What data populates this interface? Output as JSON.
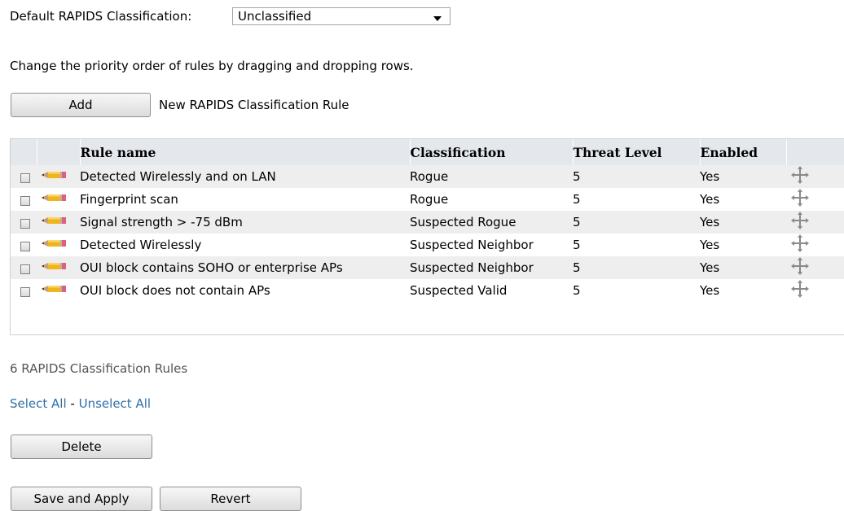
{
  "default_classification": {
    "label": "Default RAPIDS Classification:",
    "value": "Unclassified"
  },
  "instruction": "Change the priority order of rules by dragging and dropping rows.",
  "add": {
    "button_label": "Add",
    "description": "New RAPIDS Classification Rule"
  },
  "table": {
    "headers": [
      "Rule name",
      "Classification",
      "Threat Level",
      "Enabled"
    ],
    "rows": [
      {
        "name": "Detected Wirelessly and on LAN",
        "classification": "Rogue",
        "threat": "5",
        "enabled": "Yes"
      },
      {
        "name": "Fingerprint scan",
        "classification": "Rogue",
        "threat": "5",
        "enabled": "Yes"
      },
      {
        "name": "Signal strength > -75 dBm",
        "classification": "Suspected Rogue",
        "threat": "5",
        "enabled": "Yes"
      },
      {
        "name": "Detected Wirelessly",
        "classification": "Suspected Neighbor",
        "threat": "5",
        "enabled": "Yes"
      },
      {
        "name": "OUI block contains SOHO or enterprise APs",
        "classification": "Suspected Neighbor",
        "threat": "5",
        "enabled": "Yes"
      },
      {
        "name": "OUI block does not contain APs",
        "classification": "Suspected Valid",
        "threat": "5",
        "enabled": "Yes"
      }
    ]
  },
  "count_text": "6 RAPIDS Classification Rules",
  "select_all": "Select All",
  "separator": "-",
  "unselect_all": "Unselect All",
  "delete_label": "Delete",
  "save_label": "Save and Apply",
  "revert_label": "Revert",
  "icons": {
    "edit": "pencil-icon",
    "drag": "move-icon"
  }
}
